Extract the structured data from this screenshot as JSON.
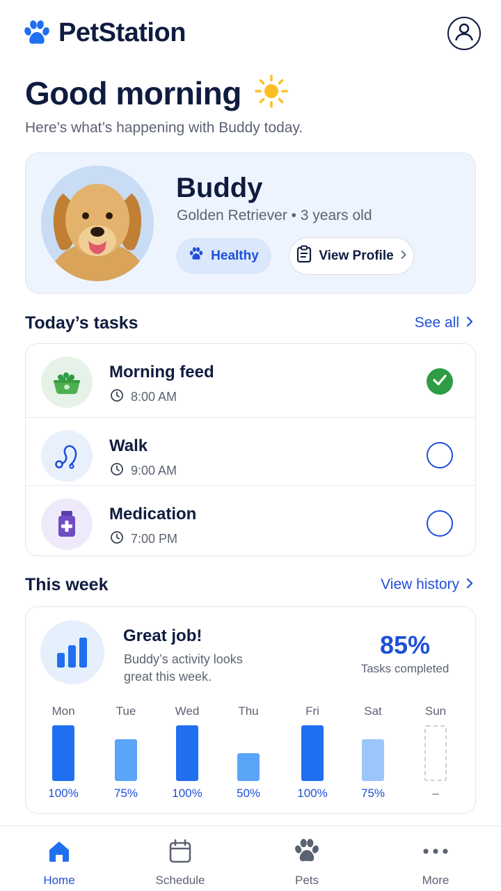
{
  "app": {
    "brand_name": "PetStation",
    "logo_icon": "paw-icon",
    "account_icon": "user-circle-icon"
  },
  "greeting": {
    "title": "Good morning",
    "icon": "sun-icon",
    "subtitle": "Here’s what’s happening with Buddy today."
  },
  "pet": {
    "name": "Buddy",
    "breed": "Golden Retriever",
    "age": "3 years old",
    "status_label": "Healthy",
    "profile_button": "View Profile"
  },
  "tasks": {
    "title": "Today’s tasks",
    "link": "See all",
    "items": [
      {
        "name": "Morning feed",
        "time": "8:00 AM",
        "icon": "food-bowl-icon",
        "done": true
      },
      {
        "name": "Walk",
        "time": "9:00 AM",
        "icon": "leash-icon",
        "done": false
      },
      {
        "name": "Medication",
        "time": "7:00 PM",
        "icon": "medicine-bottle-icon",
        "done": false
      }
    ]
  },
  "week": {
    "title": "This week",
    "link": "View history",
    "headline": "Great job!",
    "description": "Buddy’s activity looks great this week.",
    "percent": "85%",
    "percent_label": "Tasks completed",
    "days": [
      {
        "day": "Mon",
        "value": 100,
        "label": "100%"
      },
      {
        "day": "Tue",
        "value": 75,
        "label": "75%"
      },
      {
        "day": "Wed",
        "value": 100,
        "label": "100%"
      },
      {
        "day": "Thu",
        "value": 50,
        "label": "50%"
      },
      {
        "day": "Fri",
        "value": 100,
        "label": "100%"
      },
      {
        "day": "Sat",
        "value": 75,
        "label": "75%"
      },
      {
        "day": "Sun",
        "value": null,
        "label": "–"
      }
    ]
  },
  "nav": {
    "items": [
      {
        "label": "Home",
        "icon": "home-icon",
        "active": true
      },
      {
        "label": "Schedule",
        "icon": "calendar-icon",
        "active": false
      },
      {
        "label": "Pets",
        "icon": "paw-icon",
        "active": false
      },
      {
        "label": "More",
        "icon": "more-dots-icon",
        "active": false
      }
    ]
  },
  "colors": {
    "accent": "#1f4fd8",
    "bar_full": "#1f6ff0",
    "bar_mid": "#5aa5f8",
    "bar_light": "#9cc5fb",
    "success": "#2e9c45",
    "text_dark": "#0f1c3f"
  }
}
